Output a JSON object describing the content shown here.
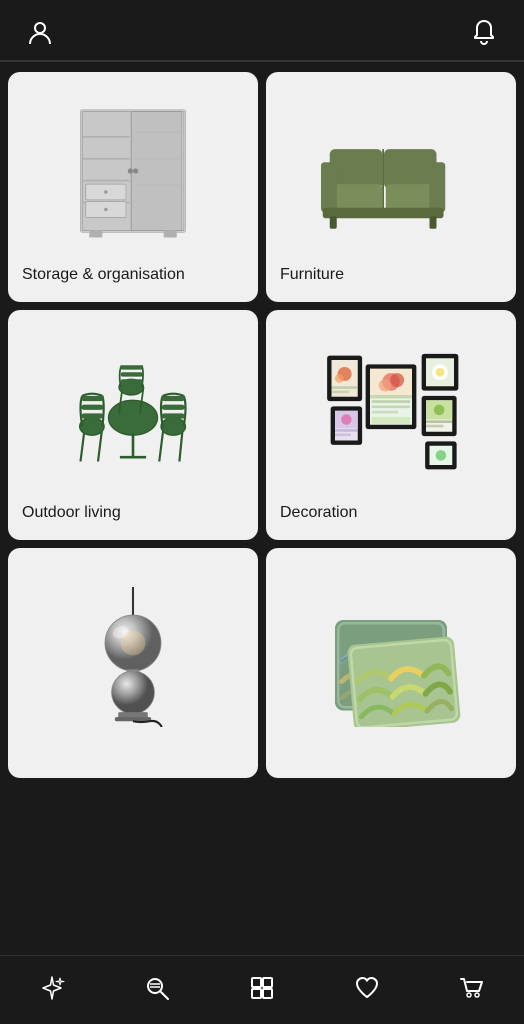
{
  "header": {
    "profile_icon": "person-icon",
    "notification_icon": "bell-icon"
  },
  "categories": [
    {
      "id": "storage",
      "label": "Storage &\norganisation",
      "color": "#f0f0f0"
    },
    {
      "id": "furniture",
      "label": "Furniture",
      "color": "#f0f0f0"
    },
    {
      "id": "outdoor",
      "label": "Outdoor living",
      "color": "#f0f0f0"
    },
    {
      "id": "decoration",
      "label": "Decoration",
      "color": "#f0f0f0"
    },
    {
      "id": "lighting",
      "label": "",
      "color": "#f0f0f0"
    },
    {
      "id": "textiles",
      "label": "",
      "color": "#f0f0f0"
    }
  ],
  "nav": {
    "items": [
      {
        "id": "sparkle",
        "label": "sparkle-icon"
      },
      {
        "id": "search",
        "label": "search-icon"
      },
      {
        "id": "store",
        "label": "store-icon"
      },
      {
        "id": "heart",
        "label": "heart-icon"
      },
      {
        "id": "cart",
        "label": "cart-icon"
      }
    ]
  }
}
